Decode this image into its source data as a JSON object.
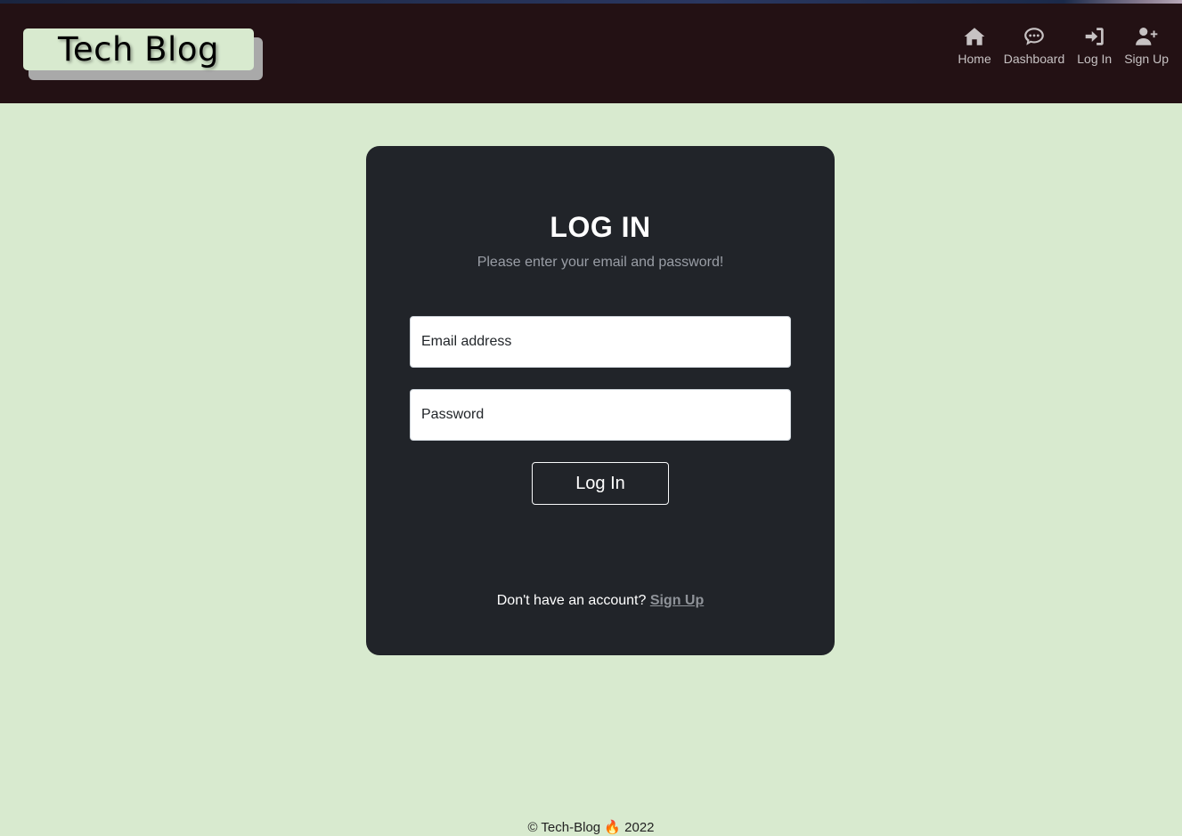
{
  "header": {
    "logo_text": "Tech Blog",
    "nav": [
      {
        "label": "Home",
        "icon": "home-icon"
      },
      {
        "label": "Dashboard",
        "icon": "comment-icon"
      },
      {
        "label": "Log In",
        "icon": "sign-in-icon"
      },
      {
        "label": "Sign Up",
        "icon": "user-plus-icon"
      }
    ]
  },
  "login": {
    "title": "LOG IN",
    "subtitle": "Please enter your email and password!",
    "email_placeholder": "Email address",
    "password_placeholder": "Password",
    "button_label": "Log In",
    "no_account_text": "Don't have an account? ",
    "signup_link": "Sign Up"
  },
  "footer": {
    "text": "© Tech-Blog 🔥 2022"
  },
  "colors": {
    "page_bg": "#d8eacf",
    "header_bg": "#231114",
    "card_bg": "#212429"
  }
}
